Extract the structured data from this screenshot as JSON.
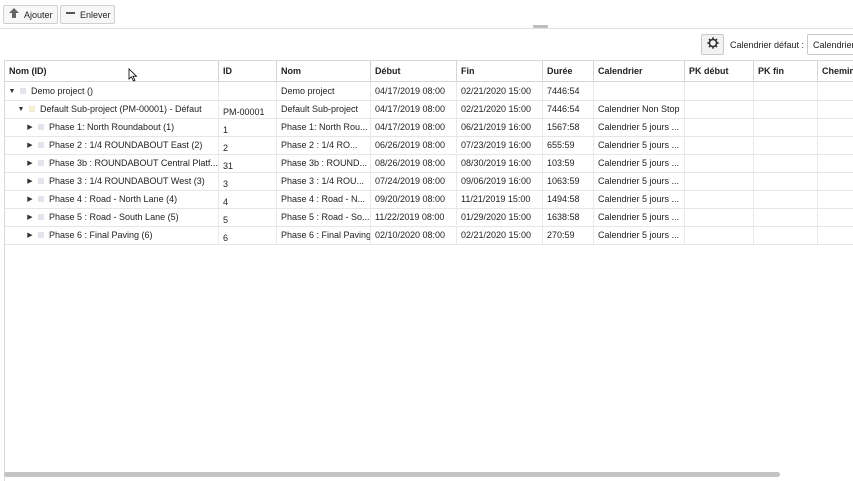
{
  "toolbar": {
    "add_label": "Ajouter",
    "remove_label": "Enlever",
    "calendar_label": "Calendrier défaut :",
    "calendar_value": "Calendrier"
  },
  "icons": {
    "add": "arrow-up-icon",
    "remove": "minus-icon",
    "settings": "gear-icon"
  },
  "grid": {
    "columns": [
      "Nom (ID)",
      "ID",
      "Nom",
      "Début",
      "Fin",
      "Durée",
      "Calendrier",
      "PK début",
      "PK fin",
      "Chemin"
    ],
    "rows": [
      {
        "level": 0,
        "expanded": true,
        "name_id": "Demo project ()",
        "id": "",
        "name": "Demo project",
        "start": "04/17/2019 08:00",
        "end": "02/21/2020 15:00",
        "duration": "7446:54",
        "calendar": "",
        "pk_start": "",
        "pk_end": "",
        "path": ""
      },
      {
        "level": 1,
        "expanded": true,
        "name_id": "Default Sub-project (PM-00001) - Défaut",
        "id": "PM-00001",
        "name": "Default Sub-project",
        "start": "04/17/2019 08:00",
        "end": "02/21/2020 15:00",
        "duration": "7446:54",
        "calendar": "Calendrier Non Stop",
        "pk_start": "",
        "pk_end": "",
        "path": ""
      },
      {
        "level": 2,
        "expanded": false,
        "name_id": "Phase 1: North Roundabout (1)",
        "id": "1",
        "name": "Phase 1: North Rou...",
        "start": "04/17/2019 08:00",
        "end": "06/21/2019 16:00",
        "duration": "1567:58",
        "calendar": "Calendrier 5 jours ...",
        "pk_start": "",
        "pk_end": "",
        "path": ""
      },
      {
        "level": 2,
        "expanded": false,
        "name_id": "Phase 2 : 1/4 ROUNDABOUT East (2)",
        "id": "2",
        "name": "Phase 2 : 1/4 RO...",
        "start": "06/26/2019 08:00",
        "end": "07/23/2019 16:00",
        "duration": "655:59",
        "calendar": "Calendrier 5 jours ...",
        "pk_start": "",
        "pk_end": "",
        "path": ""
      },
      {
        "level": 2,
        "expanded": false,
        "name_id": "Phase 3b : ROUNDABOUT Central Platf...",
        "id": "31",
        "name": "Phase 3b : ROUND...",
        "start": "08/26/2019 08:00",
        "end": "08/30/2019 16:00",
        "duration": "103:59",
        "calendar": "Calendrier 5 jours ...",
        "pk_start": "",
        "pk_end": "",
        "path": ""
      },
      {
        "level": 2,
        "expanded": false,
        "name_id": "Phase 3 : 1/4 ROUNDABOUT West (3)",
        "id": "3",
        "name": "Phase 3 : 1/4 ROU...",
        "start": "07/24/2019 08:00",
        "end": "09/06/2019 16:00",
        "duration": "1063:59",
        "calendar": "Calendrier 5 jours ...",
        "pk_start": "",
        "pk_end": "",
        "path": ""
      },
      {
        "level": 2,
        "expanded": false,
        "name_id": "Phase 4 : Road - North Lane (4)",
        "id": "4",
        "name": "Phase 4 : Road - N...",
        "start": "09/20/2019 08:00",
        "end": "11/21/2019 15:00",
        "duration": "1494:58",
        "calendar": "Calendrier 5 jours ...",
        "pk_start": "",
        "pk_end": "",
        "path": ""
      },
      {
        "level": 2,
        "expanded": false,
        "name_id": "Phase 5 : Road - South Lane (5)",
        "id": "5",
        "name": "Phase 5 : Road - So...",
        "start": "11/22/2019 08:00",
        "end": "01/29/2020 15:00",
        "duration": "1638:58",
        "calendar": "Calendrier 5 jours ...",
        "pk_start": "",
        "pk_end": "",
        "path": ""
      },
      {
        "level": 2,
        "expanded": false,
        "name_id": "Phase 6 : Final Paving (6)",
        "id": "6",
        "name": "Phase 6 : Final Paving",
        "start": "02/10/2020 08:00",
        "end": "02/21/2020 15:00",
        "duration": "270:59",
        "calendar": "Calendrier 5 jours ...",
        "pk_start": "",
        "pk_end": "",
        "path": ""
      }
    ]
  }
}
